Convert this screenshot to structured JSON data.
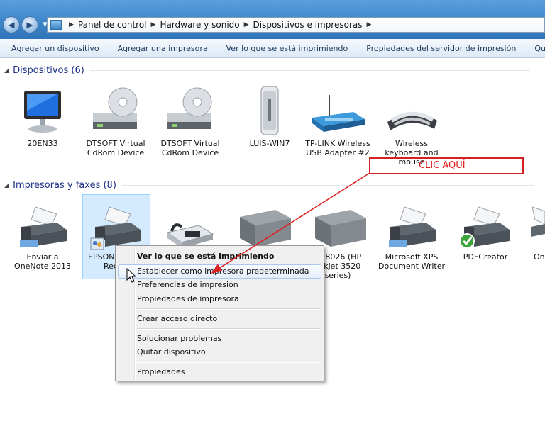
{
  "address": {
    "crumbs": [
      "Panel de control",
      "Hardware y sonido",
      "Dispositivos e impresoras"
    ]
  },
  "commands": [
    "Agregar un dispositivo",
    "Agregar una impresora",
    "Ver lo que se está imprimiendo",
    "Propiedades del servidor de impresión",
    "Quitar dispositivo"
  ],
  "groups": {
    "devices": "Dispositivos (6)",
    "printers": "Impresoras y faxes (8)"
  },
  "devices": [
    {
      "label": "20EN33",
      "icon": "monitor-icon"
    },
    {
      "label": "DTSOFT Virtual CdRom Device",
      "icon": "cdrom-drive-icon"
    },
    {
      "label": "DTSOFT Virtual CdRom Device",
      "icon": "cdrom-drive-icon"
    },
    {
      "label": "LUIS-WIN7",
      "icon": "computer-tower-icon"
    },
    {
      "label": "TP-LINK Wireless USB Adapter #2",
      "icon": "wireless-adapter-icon"
    },
    {
      "label": "Wireless keyboard and mouse",
      "icon": "keyboard-icon"
    }
  ],
  "printers": [
    {
      "label": "Enviar a OneNote 2013",
      "icon": "printer-icon"
    },
    {
      "label": "EPSON ... Rec",
      "line1": "EPSON",
      "line2": "Rec",
      "icon": "printer-icon"
    },
    {
      "label": "",
      "icon": "fax-icon"
    },
    {
      "label": "",
      "icon": "multifunction-printer-icon"
    },
    {
      "label": "D18026 (HP eskjet 3520 series)",
      "line1": "D18026 (HP",
      "line2": "eskjet 3520",
      "line3": "series)",
      "icon": "multifunction-printer-icon"
    },
    {
      "label": "Microsoft XPS Document Writer",
      "icon": "printer-icon"
    },
    {
      "label": "PDFCreator",
      "icon": "printer-icon"
    },
    {
      "label": "On",
      "icon": "printer-icon"
    }
  ],
  "context_menu": {
    "items": [
      {
        "label": "Ver lo que se está imprimiendo",
        "bold": true
      },
      {
        "label": "Establecer como impresora predeterminada"
      },
      {
        "label": "Preferencias de impresión"
      },
      {
        "label": "Propiedades de impresora"
      },
      {
        "label": "Crear acceso directo"
      },
      {
        "label": "Solucionar problemas"
      },
      {
        "label": "Quitar dispositivo"
      },
      {
        "label": "Propiedades"
      }
    ]
  },
  "annotation": {
    "text": "CLIC AQUÍ",
    "color": "#e02020"
  },
  "colors": {
    "accent": "#2f74b8",
    "group_text": "#1e3287",
    "highlight": "#cce8ff"
  }
}
